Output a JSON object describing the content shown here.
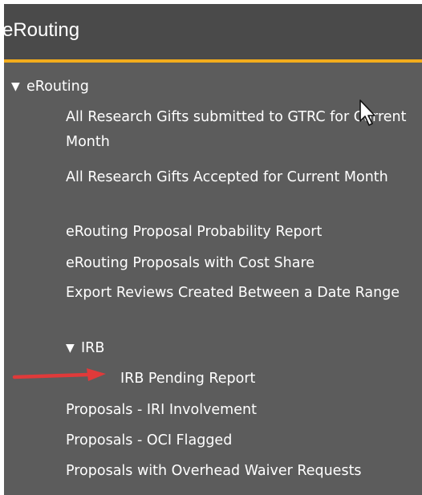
{
  "header": {
    "title": "eRouting"
  },
  "tree": {
    "root_label": "eRouting",
    "items": [
      "All Research Gifts submitted to GTRC for Current Month",
      "All Research Gifts Accepted for Current Month",
      "eRouting Proposal Probability Report",
      "eRouting Proposals with Cost Share",
      "Export Reviews Created Between a Date Range"
    ],
    "subfolder_label": "IRB",
    "subfolder_items": [
      "IRB Pending Report"
    ],
    "more_items": [
      "Proposals - IRI Involvement",
      "Proposals - OCI Flagged",
      "Proposals with Overhead Waiver Requests"
    ]
  },
  "colors": {
    "panel_bg": "#5c5c5c",
    "header_bg": "#4a4a4a",
    "accent": "#f2ac1c",
    "text": "#ffffff",
    "annotation_arrow": "#e03a3a"
  },
  "icons": {
    "expand": "triangle-down-icon",
    "pointer": "mouse-pointer-icon",
    "annotation": "red-arrow-icon"
  }
}
